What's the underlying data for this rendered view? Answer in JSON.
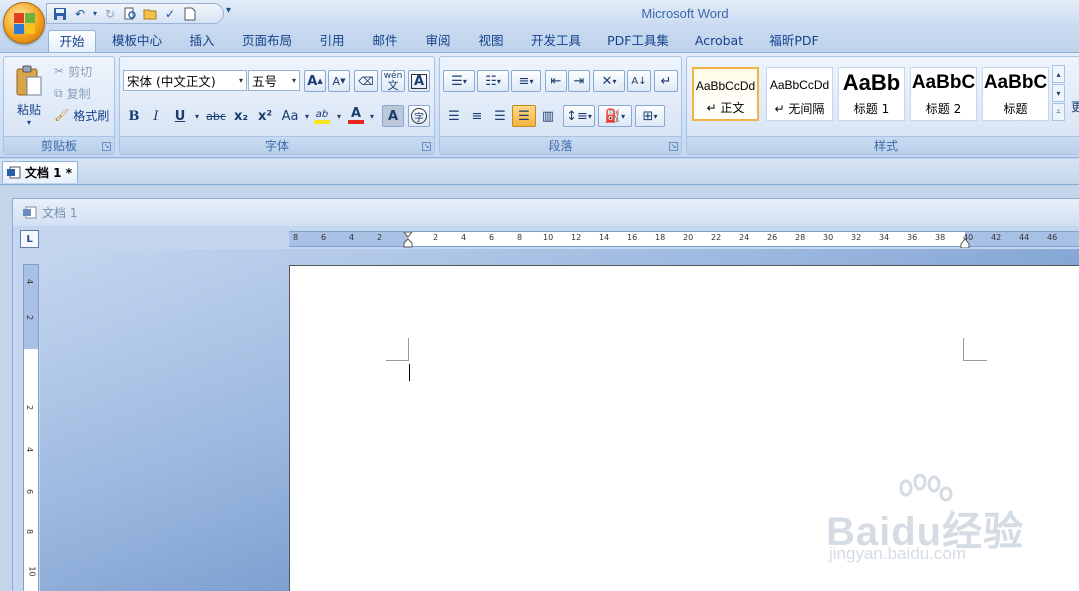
{
  "window": {
    "title": "Microsoft Word"
  },
  "ribbon_tabs": [
    "开始",
    "模板中心",
    "插入",
    "页面布局",
    "引用",
    "邮件",
    "审阅",
    "视图",
    "开发工具",
    "PDF工具集",
    "Acrobat",
    "福昕PDF"
  ],
  "clipboard": {
    "paste": "粘贴",
    "cut": "剪切",
    "copy": "复制",
    "format_painter": "格式刷",
    "group_label": "剪贴板"
  },
  "font": {
    "name": "宋体 (中文正文)",
    "size": "五号",
    "group_label": "字体",
    "buttons": {
      "bold": "B",
      "italic": "I",
      "underline": "U",
      "strike": "abc",
      "subscript": "x₂",
      "superscript": "x²",
      "case": "Aa",
      "grow": "A",
      "shrink": "A",
      "phonetic": "wén",
      "border": "A",
      "shading": "A",
      "enclose": "字",
      "highlight": "ab",
      "color": "A",
      "clear": "A"
    }
  },
  "paragraph": {
    "group_label": "段落"
  },
  "styles": {
    "group_label": "样式",
    "more": "更",
    "items": [
      {
        "preview": "AaBbCcDd",
        "name": "正文"
      },
      {
        "preview": "AaBbCcDd",
        "name": "无间隔"
      },
      {
        "preview": "AaBb",
        "name": "标题 1"
      },
      {
        "preview": "AaBbC",
        "name": "标题 2"
      },
      {
        "preview": "AaBbC",
        "name": "标题"
      }
    ]
  },
  "document": {
    "tab": "文档 1 *",
    "mdi_title": "文档 1",
    "ruler_tab": "L"
  },
  "hruler": {
    "left": [
      "8",
      "6",
      "4",
      "2"
    ],
    "right": [
      "2",
      "4",
      "6",
      "8",
      "10",
      "12",
      "14",
      "16",
      "18",
      "20",
      "22",
      "24",
      "26",
      "28",
      "30",
      "32",
      "34",
      "36",
      "38",
      "40",
      "42",
      "44",
      "46"
    ]
  },
  "vruler": [
    "4",
    "2",
    "2",
    "4",
    "6",
    "8",
    "10"
  ],
  "watermark": {
    "main": "Baidu经验",
    "sub": "jingyan.baidu.com"
  },
  "colors": {
    "highlight": "#f7e51c",
    "font_color": "#e8251b",
    "accent": "#15428b"
  }
}
